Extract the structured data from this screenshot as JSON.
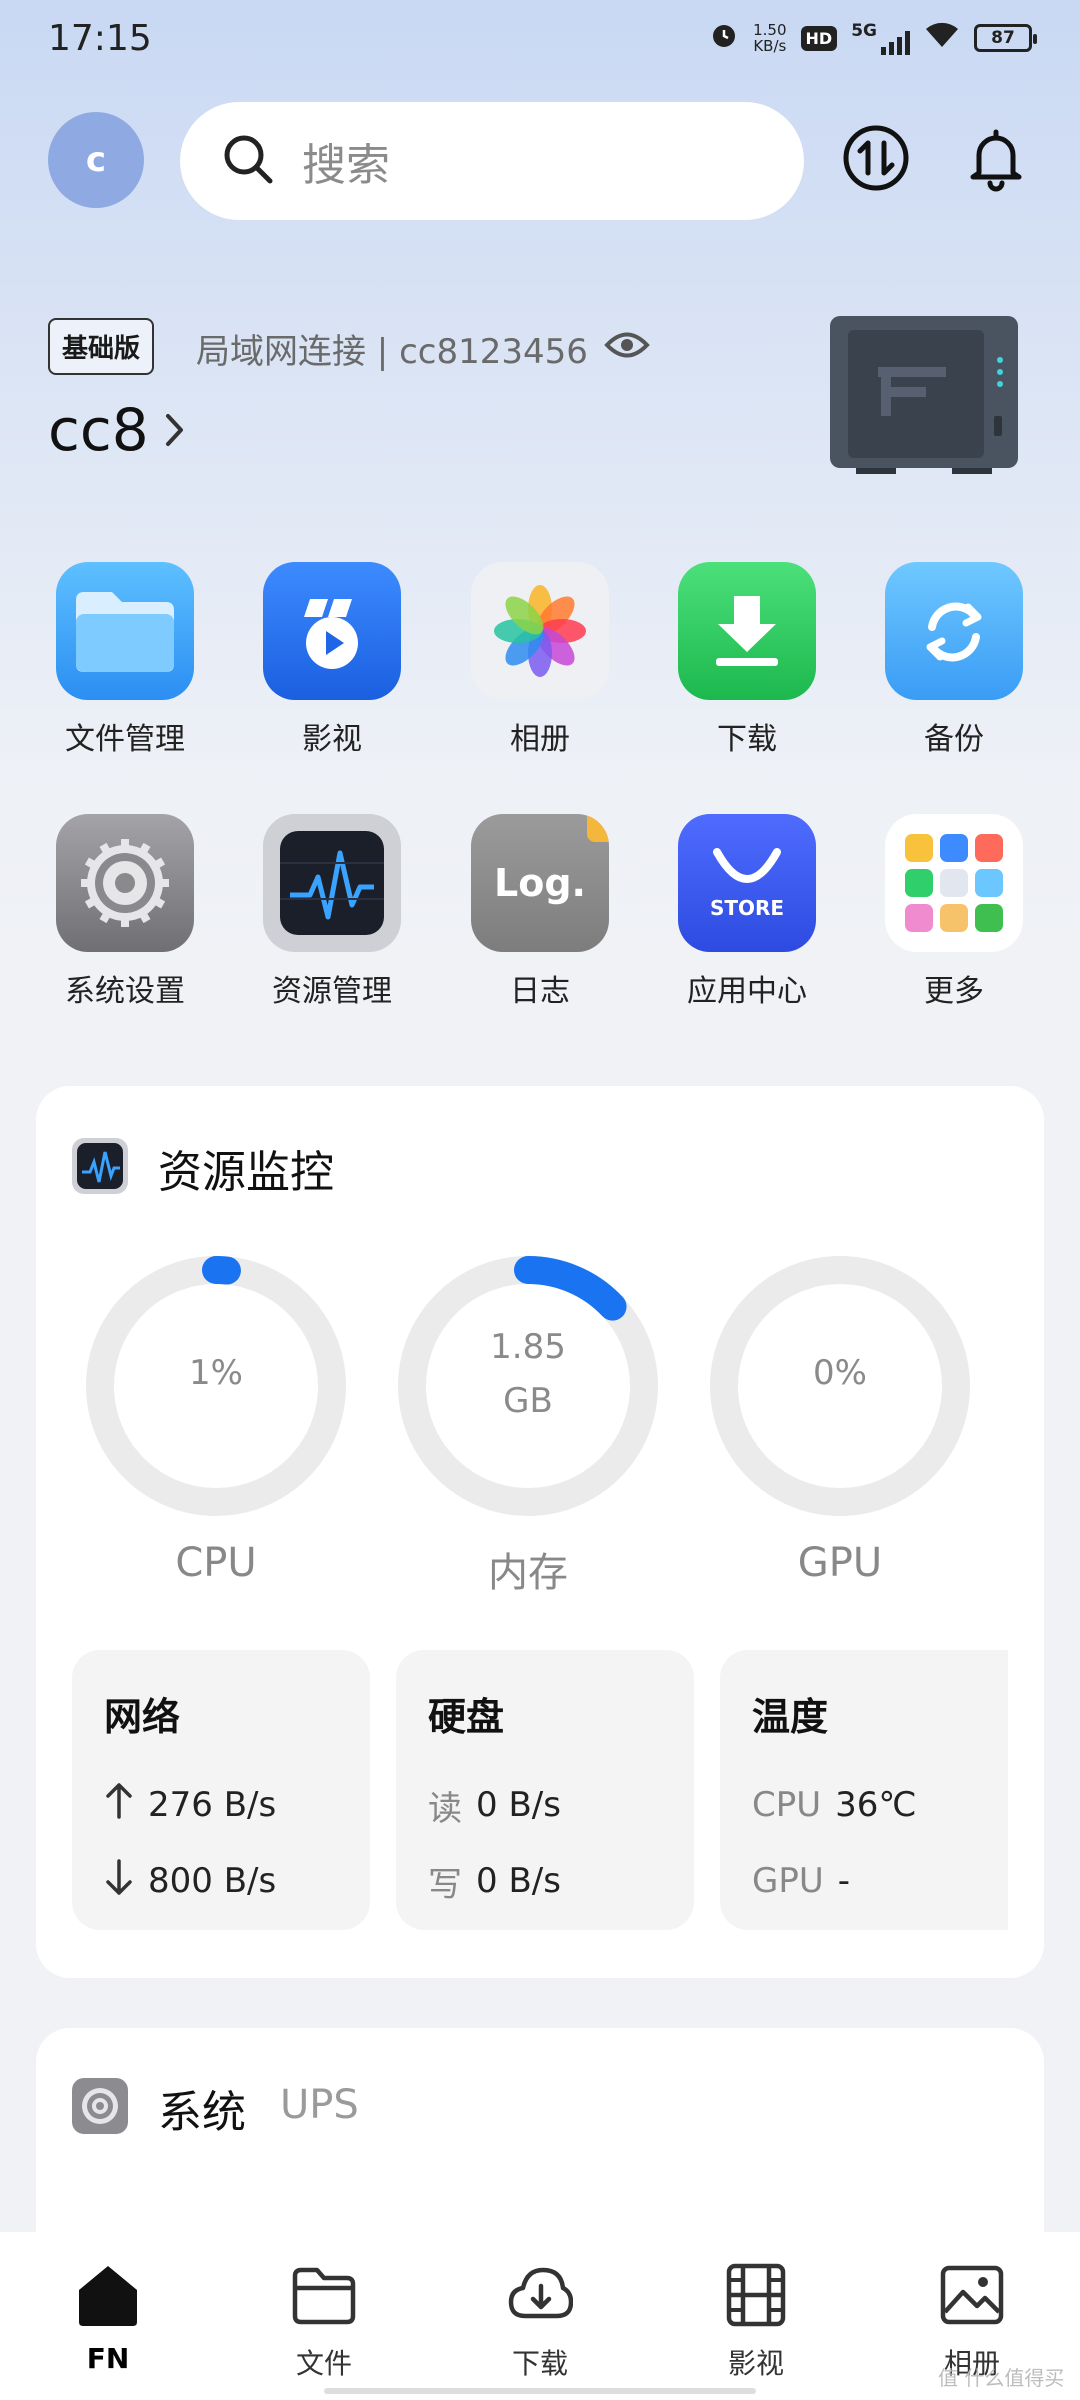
{
  "status": {
    "time": "17:15",
    "speed_value": "1.50",
    "speed_unit": "KB/s",
    "hd": "HD",
    "net": "5G",
    "battery": "87"
  },
  "header": {
    "avatar_letter": "c",
    "search_placeholder": "搜索"
  },
  "device": {
    "plan": "基础版",
    "connection": "局域网连接 | cc8123456",
    "name": "cc8"
  },
  "apps": [
    {
      "label": "文件管理",
      "icon": "folder-icon"
    },
    {
      "label": "影视",
      "icon": "video-icon"
    },
    {
      "label": "相册",
      "icon": "photos-icon"
    },
    {
      "label": "下载",
      "icon": "download-icon"
    },
    {
      "label": "备份",
      "icon": "backup-icon"
    },
    {
      "label": "系统设置",
      "icon": "gear-icon"
    },
    {
      "label": "资源管理",
      "icon": "monitor-icon"
    },
    {
      "label": "日志",
      "icon": "log-icon",
      "icon_text": "Log."
    },
    {
      "label": "应用中心",
      "icon": "store-icon",
      "icon_text": "STORE"
    },
    {
      "label": "更多",
      "icon": "more-grid-icon"
    }
  ],
  "monitor": {
    "title": "资源监控",
    "gauges": [
      {
        "label": "CPU",
        "value_line1": "1%",
        "value_line2": "",
        "fraction": 0.01
      },
      {
        "label": "内存",
        "value_line1": "1.85",
        "value_line2": "GB",
        "fraction": 0.13
      },
      {
        "label": "GPU",
        "value_line1": "0%",
        "value_line2": "",
        "fraction": 0.0
      }
    ],
    "network": {
      "title": "网络",
      "up": "276 B/s",
      "down": "800 B/s"
    },
    "disk": {
      "title": "硬盘",
      "read_key": "读",
      "read": "0 B/s",
      "write_key": "写",
      "write": "0 B/s"
    },
    "temp": {
      "title": "温度",
      "cpu_key": "CPU",
      "cpu": "36℃",
      "gpu_key": "GPU",
      "gpu": "-"
    }
  },
  "system": {
    "title": "系统",
    "subtitle": "UPS"
  },
  "nav": [
    {
      "label": "FN",
      "icon": "home-icon"
    },
    {
      "label": "文件",
      "icon": "folder-outline-icon"
    },
    {
      "label": "下载",
      "icon": "cloud-download-icon"
    },
    {
      "label": "影视",
      "icon": "film-icon"
    },
    {
      "label": "相册",
      "icon": "image-icon"
    }
  ],
  "watermark": "值 什么值得买",
  "colors": {
    "accent": "#1a73f0",
    "gauge_track": "#ebebeb"
  }
}
